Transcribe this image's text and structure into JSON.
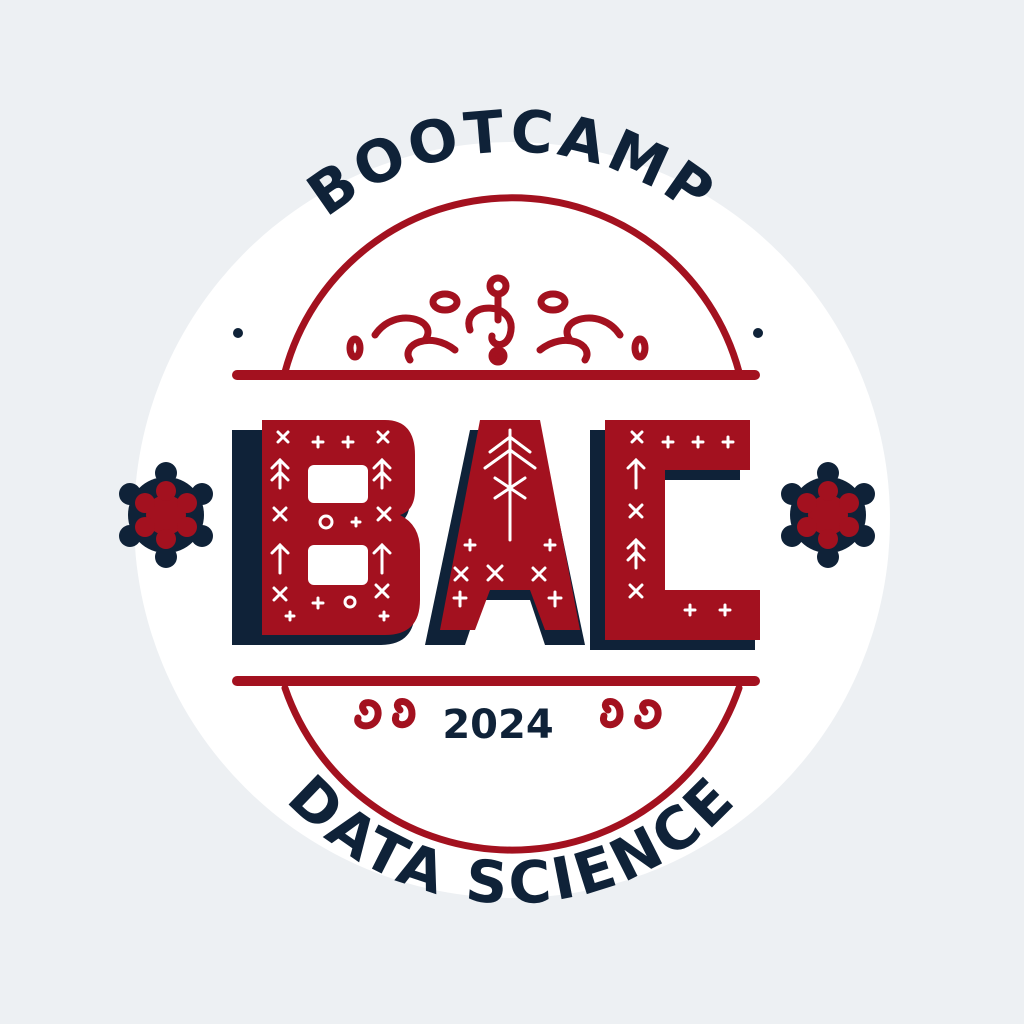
{
  "logo": {
    "top_text": "BOOTCAMP",
    "monogram": [
      "B",
      "A",
      "C"
    ],
    "year": "2024",
    "bottom_text": "DATA SCIENCE"
  },
  "colors": {
    "background": "#edf0f3",
    "disc": "#ffffff",
    "crimson": "#a3111f",
    "navy": "#0f2238",
    "ornament_white": "#ffffff"
  },
  "icons": {
    "left_emblem": "gear-snowflake-icon",
    "right_emblem": "gear-snowflake-icon",
    "ornament": "folk-embroidery-ornament"
  }
}
